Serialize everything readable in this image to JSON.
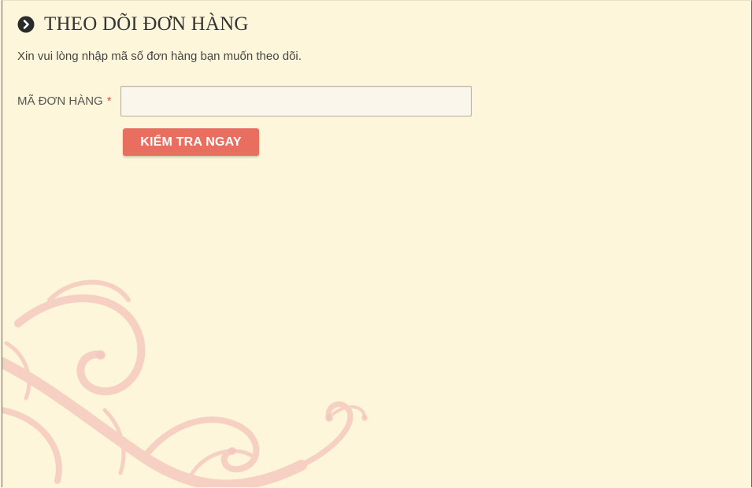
{
  "page": {
    "title": "THEO DÕI ĐƠN HÀNG",
    "instructions": "Xin vui lòng nhập mã số đơn hàng bạn muốn theo dõi."
  },
  "form": {
    "order_label": "MÃ ĐƠN HÀNG",
    "required_mark": "*",
    "order_value": "",
    "order_placeholder": "",
    "submit_label": "KIỂM TRA NGAY"
  },
  "icons": {
    "header": "chevron-right-circle-icon",
    "decoration": "floral-swirl"
  },
  "colors": {
    "background": "#fef6da",
    "button": "#e86f5f",
    "required": "#d9534f",
    "swirl": "#f3c4bc"
  }
}
